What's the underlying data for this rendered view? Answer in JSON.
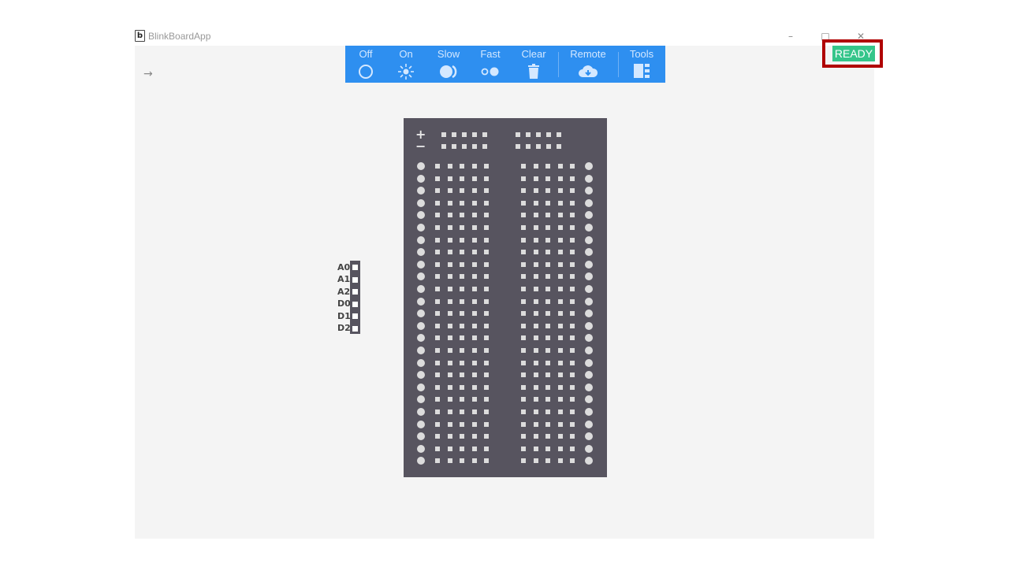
{
  "window": {
    "title": "BlinkBoardApp",
    "app_icon_glyph": "b",
    "controls": {
      "minimize": "–",
      "maximize": "□",
      "close": "✕"
    },
    "nav_arrow": "→"
  },
  "toolbar": {
    "items": [
      {
        "label": "Off",
        "icon": "circle-outline-icon"
      },
      {
        "label": "On",
        "icon": "sun-icon"
      },
      {
        "label": "Slow",
        "icon": "slow-blink-icon"
      },
      {
        "label": "Fast",
        "icon": "fast-blink-icon"
      },
      {
        "label": "Clear",
        "icon": "trash-icon"
      },
      {
        "label": "Remote",
        "icon": "cloud-download-icon"
      },
      {
        "label": "Tools",
        "icon": "tools-panel-icon"
      }
    ],
    "background": "#2e8ff0"
  },
  "status": {
    "text": "READY",
    "color": "#35c58a",
    "highlight_color": "#b00000"
  },
  "pins": {
    "labels": [
      "A0",
      "A1",
      "A2",
      "D0",
      "D1",
      "D2"
    ]
  },
  "breadboard": {
    "rail_plus": "+",
    "rail_minus": "−",
    "rows": 25,
    "color": "#57545f"
  }
}
